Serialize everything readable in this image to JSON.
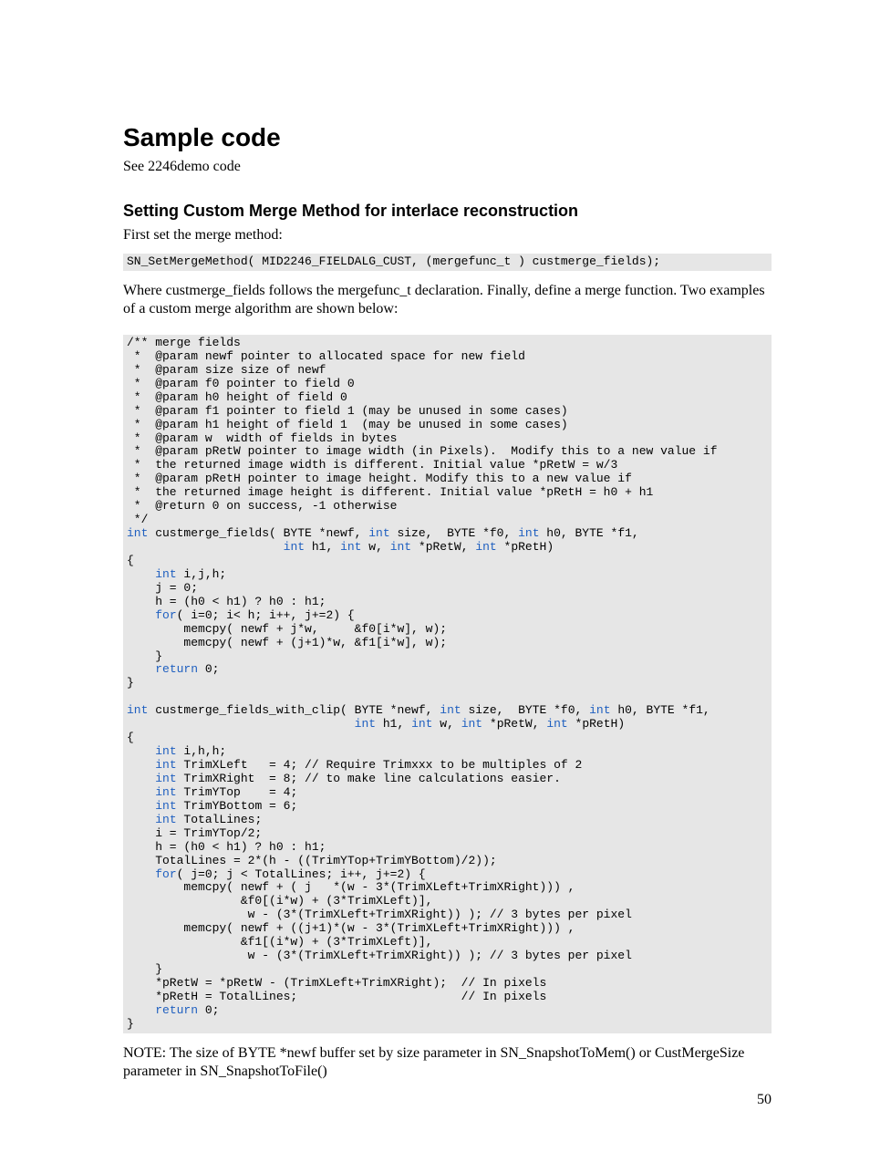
{
  "title": "Sample code",
  "see_line": "See 2246demo code",
  "subhead": "Setting Custom Merge Method for interlace reconstruction",
  "first_set": "First set the merge method:",
  "code_set": "SN_SetMergeMethod( MID2246_FIELDALG_CUST, (mergefunc_t ) custmerge_fields);",
  "where_para": "Where custmerge_fields follows the mergefunc_t declaration.  Finally, define a merge function.  Two examples of  a custom merge algorithm are shown below:",
  "listing": {
    "lines": [
      {
        "segs": [
          {
            "t": "/** merge fields"
          }
        ]
      },
      {
        "segs": [
          {
            "t": " *  @param newf pointer to allocated space for new field"
          }
        ]
      },
      {
        "segs": [
          {
            "t": " *  @param size size of newf"
          }
        ]
      },
      {
        "segs": [
          {
            "t": " *  @param f0 pointer to field 0"
          }
        ]
      },
      {
        "segs": [
          {
            "t": " *  @param h0 height of field 0"
          }
        ]
      },
      {
        "segs": [
          {
            "t": " *  @param f1 pointer to field 1 (may be unused in some cases)"
          }
        ]
      },
      {
        "segs": [
          {
            "t": " *  @param h1 height of field 1  (may be unused in some cases)"
          }
        ]
      },
      {
        "segs": [
          {
            "t": " *  @param w  width of fields in bytes"
          }
        ]
      },
      {
        "segs": [
          {
            "t": " *  @param pRetW pointer to image width (in Pixels).  Modify this to a new value if"
          }
        ]
      },
      {
        "segs": [
          {
            "t": " *  the returned image width is different. Initial value *pRetW = w/3"
          }
        ]
      },
      {
        "segs": [
          {
            "t": " *  @param pRetH pointer to image height. Modify this to a new value if"
          }
        ]
      },
      {
        "segs": [
          {
            "t": " *  the returned image height is different. Initial value *pRetH = h0 + h1"
          }
        ]
      },
      {
        "segs": [
          {
            "t": " *  @return 0 on success, -1 otherwise"
          }
        ]
      },
      {
        "segs": [
          {
            "t": " */"
          }
        ]
      },
      {
        "segs": [
          {
            "t": "int",
            "kw": true
          },
          {
            "t": " custmerge_fields( BYTE *newf, "
          },
          {
            "t": "int",
            "kw": true
          },
          {
            "t": " size,  BYTE *f0, "
          },
          {
            "t": "int",
            "kw": true
          },
          {
            "t": " h0, BYTE *f1,"
          }
        ]
      },
      {
        "segs": [
          {
            "t": "                      "
          },
          {
            "t": "int",
            "kw": true
          },
          {
            "t": " h1, "
          },
          {
            "t": "int",
            "kw": true
          },
          {
            "t": " w, "
          },
          {
            "t": "int",
            "kw": true
          },
          {
            "t": " *pRetW, "
          },
          {
            "t": "int",
            "kw": true
          },
          {
            "t": " *pRetH)"
          }
        ]
      },
      {
        "segs": [
          {
            "t": "{"
          }
        ]
      },
      {
        "segs": [
          {
            "t": "    "
          },
          {
            "t": "int",
            "kw": true
          },
          {
            "t": " i,j,h;"
          }
        ]
      },
      {
        "segs": [
          {
            "t": "    j = 0;"
          }
        ]
      },
      {
        "segs": [
          {
            "t": "    h = (h0 < h1) ? h0 : h1;"
          }
        ]
      },
      {
        "segs": [
          {
            "t": "    "
          },
          {
            "t": "for",
            "kw": true
          },
          {
            "t": "( i=0; i< h; i++, j+=2) {"
          }
        ]
      },
      {
        "segs": [
          {
            "t": "        memcpy( newf + j*w,     &f0[i*w], w);"
          }
        ]
      },
      {
        "segs": [
          {
            "t": "        memcpy( newf + (j+1)*w, &f1[i*w], w);"
          }
        ]
      },
      {
        "segs": [
          {
            "t": "    }"
          }
        ]
      },
      {
        "segs": [
          {
            "t": "    "
          },
          {
            "t": "return",
            "kw": true
          },
          {
            "t": " 0;"
          }
        ]
      },
      {
        "segs": [
          {
            "t": "}"
          }
        ]
      },
      {
        "segs": [
          {
            "t": ""
          }
        ]
      },
      {
        "segs": [
          {
            "t": "int",
            "kw": true
          },
          {
            "t": " custmerge_fields_with_clip( BYTE *newf, "
          },
          {
            "t": "int",
            "kw": true
          },
          {
            "t": " size,  BYTE *f0, "
          },
          {
            "t": "int",
            "kw": true
          },
          {
            "t": " h0, BYTE *f1,"
          }
        ]
      },
      {
        "segs": [
          {
            "t": "                                "
          },
          {
            "t": "int",
            "kw": true
          },
          {
            "t": " h1, "
          },
          {
            "t": "int",
            "kw": true
          },
          {
            "t": " w, "
          },
          {
            "t": "int",
            "kw": true
          },
          {
            "t": " *pRetW, "
          },
          {
            "t": "int",
            "kw": true
          },
          {
            "t": " *pRetH)"
          }
        ]
      },
      {
        "segs": [
          {
            "t": "{"
          }
        ]
      },
      {
        "segs": [
          {
            "t": "    "
          },
          {
            "t": "int",
            "kw": true
          },
          {
            "t": " i,h,h;"
          }
        ]
      },
      {
        "segs": [
          {
            "t": "    "
          },
          {
            "t": "int",
            "kw": true
          },
          {
            "t": " TrimXLeft   = 4; // Require Trimxxx to be multiples of 2"
          }
        ]
      },
      {
        "segs": [
          {
            "t": "    "
          },
          {
            "t": "int",
            "kw": true
          },
          {
            "t": " TrimXRight  = 8; // to make line calculations easier."
          }
        ]
      },
      {
        "segs": [
          {
            "t": "    "
          },
          {
            "t": "int",
            "kw": true
          },
          {
            "t": " TrimYTop    = 4;"
          }
        ]
      },
      {
        "segs": [
          {
            "t": "    "
          },
          {
            "t": "int",
            "kw": true
          },
          {
            "t": " TrimYBottom = 6;"
          }
        ]
      },
      {
        "segs": [
          {
            "t": "    "
          },
          {
            "t": "int",
            "kw": true
          },
          {
            "t": " TotalLines;"
          }
        ]
      },
      {
        "segs": [
          {
            "t": "    i = TrimYTop/2;"
          }
        ]
      },
      {
        "segs": [
          {
            "t": "    h = (h0 < h1) ? h0 : h1;"
          }
        ]
      },
      {
        "segs": [
          {
            "t": "    TotalLines = 2*(h - ((TrimYTop+TrimYBottom)/2));"
          }
        ]
      },
      {
        "segs": [
          {
            "t": "    "
          },
          {
            "t": "for",
            "kw": true
          },
          {
            "t": "( j=0; j < TotalLines; i++, j+=2) {"
          }
        ]
      },
      {
        "segs": [
          {
            "t": "        memcpy( newf + ( j   *(w - 3*(TrimXLeft+TrimXRight))) ,"
          }
        ]
      },
      {
        "segs": [
          {
            "t": "                &f0[(i*w) + (3*TrimXLeft)],"
          }
        ]
      },
      {
        "segs": [
          {
            "t": "                 w - (3*(TrimXLeft+TrimXRight)) ); // 3 bytes per pixel"
          }
        ]
      },
      {
        "segs": [
          {
            "t": "        memcpy( newf + ((j+1)*(w - 3*(TrimXLeft+TrimXRight))) ,"
          }
        ]
      },
      {
        "segs": [
          {
            "t": "                &f1[(i*w) + (3*TrimXLeft)],"
          }
        ]
      },
      {
        "segs": [
          {
            "t": "                 w - (3*(TrimXLeft+TrimXRight)) ); // 3 bytes per pixel"
          }
        ]
      },
      {
        "segs": [
          {
            "t": "    }"
          }
        ]
      },
      {
        "segs": [
          {
            "t": "    *pRetW = *pRetW - (TrimXLeft+TrimXRight);  // In pixels"
          }
        ]
      },
      {
        "segs": [
          {
            "t": "    *pRetH = TotalLines;                       // In pixels"
          }
        ]
      },
      {
        "segs": [
          {
            "t": "    "
          },
          {
            "t": "return",
            "kw": true
          },
          {
            "t": " 0;"
          }
        ]
      },
      {
        "segs": [
          {
            "t": "}"
          }
        ]
      }
    ]
  },
  "note": "NOTE: The size of  BYTE *newf buffer set by size parameter in SN_SnapshotToMem() or CustMergeSize parameter in SN_SnapshotToFile()",
  "pagenum": "50"
}
